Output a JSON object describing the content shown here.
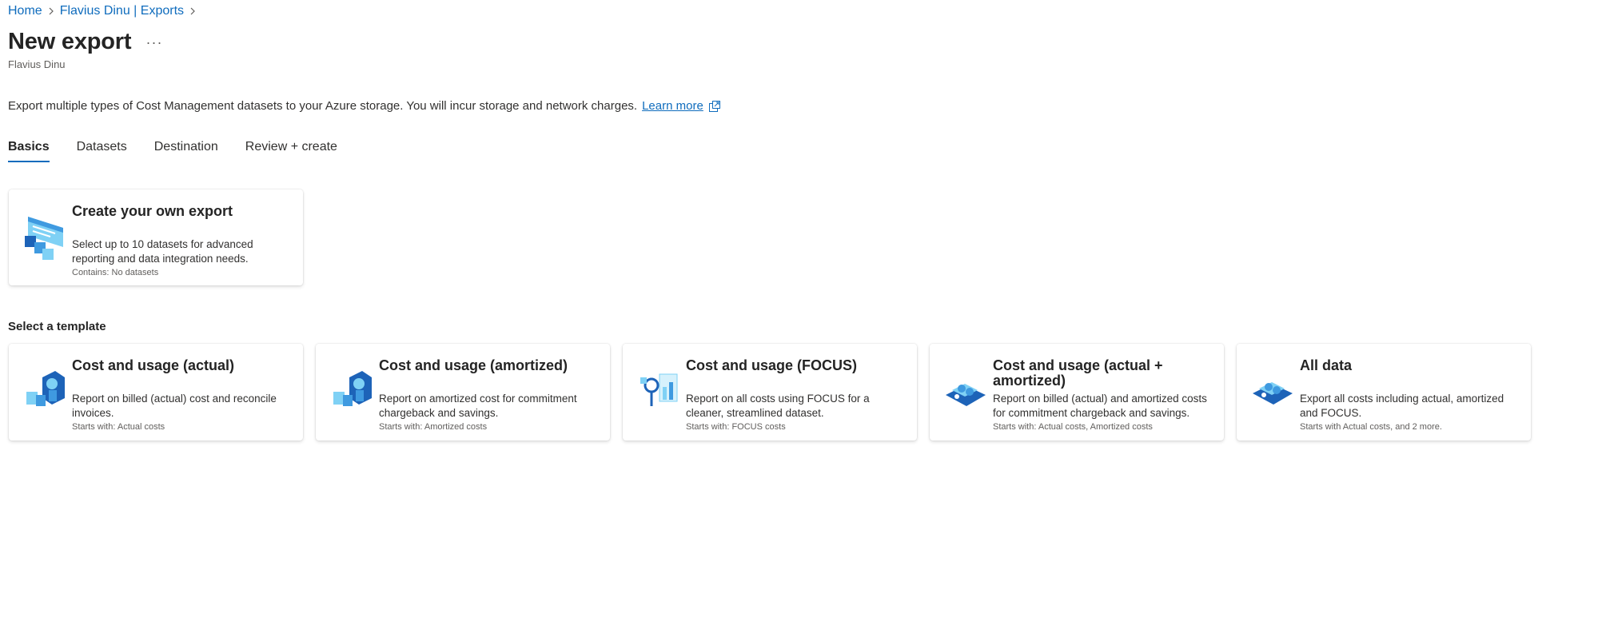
{
  "breadcrumb": {
    "items": [
      "Home",
      "Flavius Dinu | Exports"
    ]
  },
  "header": {
    "title": "New export",
    "more_label": "···",
    "subtitle": "Flavius Dinu"
  },
  "description": {
    "text": "Export multiple types of Cost Management datasets to your Azure storage. You will incur storage and network charges.",
    "link": "Learn more"
  },
  "tabs": [
    {
      "label": "Basics",
      "active": true
    },
    {
      "label": "Datasets"
    },
    {
      "label": "Destination"
    },
    {
      "label": "Review + create"
    }
  ],
  "custom_card": {
    "title": "Create your own export",
    "description": "Select up to 10 datasets for advanced reporting and data integration needs.",
    "meta": "Contains: No datasets",
    "icon": "custom-export-icon"
  },
  "templates_heading": "Select a template",
  "templates": [
    {
      "title": "Cost and usage (actual)",
      "description": "Report on billed (actual) cost and reconcile invoices.",
      "meta": "Starts with: Actual costs",
      "icon": "cost-actual-icon"
    },
    {
      "title": "Cost and usage (amortized)",
      "description": "Report on amortized cost for commitment chargeback and savings.",
      "meta": "Starts with: Amortized costs",
      "icon": "cost-amortized-icon"
    },
    {
      "title": "Cost and usage (FOCUS)",
      "description": "Report on all costs using FOCUS for a cleaner, streamlined dataset.",
      "meta": "Starts with: FOCUS costs",
      "icon": "cost-focus-icon"
    },
    {
      "title": "Cost and usage (actual + amortized)",
      "description": "Report on billed (actual) and amortized costs for commitment chargeback and savings.",
      "meta": "Starts with: Actual costs, Amortized costs",
      "icon": "cost-actual-amortized-icon"
    },
    {
      "title": "All data",
      "description": "Export all costs including actual, amortized and FOCUS.",
      "meta": "Starts with Actual costs, and 2 more.",
      "icon": "all-data-icon"
    }
  ],
  "colors": {
    "accent": "#0f6cbd",
    "icon_dark": "#1d63b8",
    "icon_mid": "#3f9ae0",
    "icon_light": "#7fd1f5"
  }
}
